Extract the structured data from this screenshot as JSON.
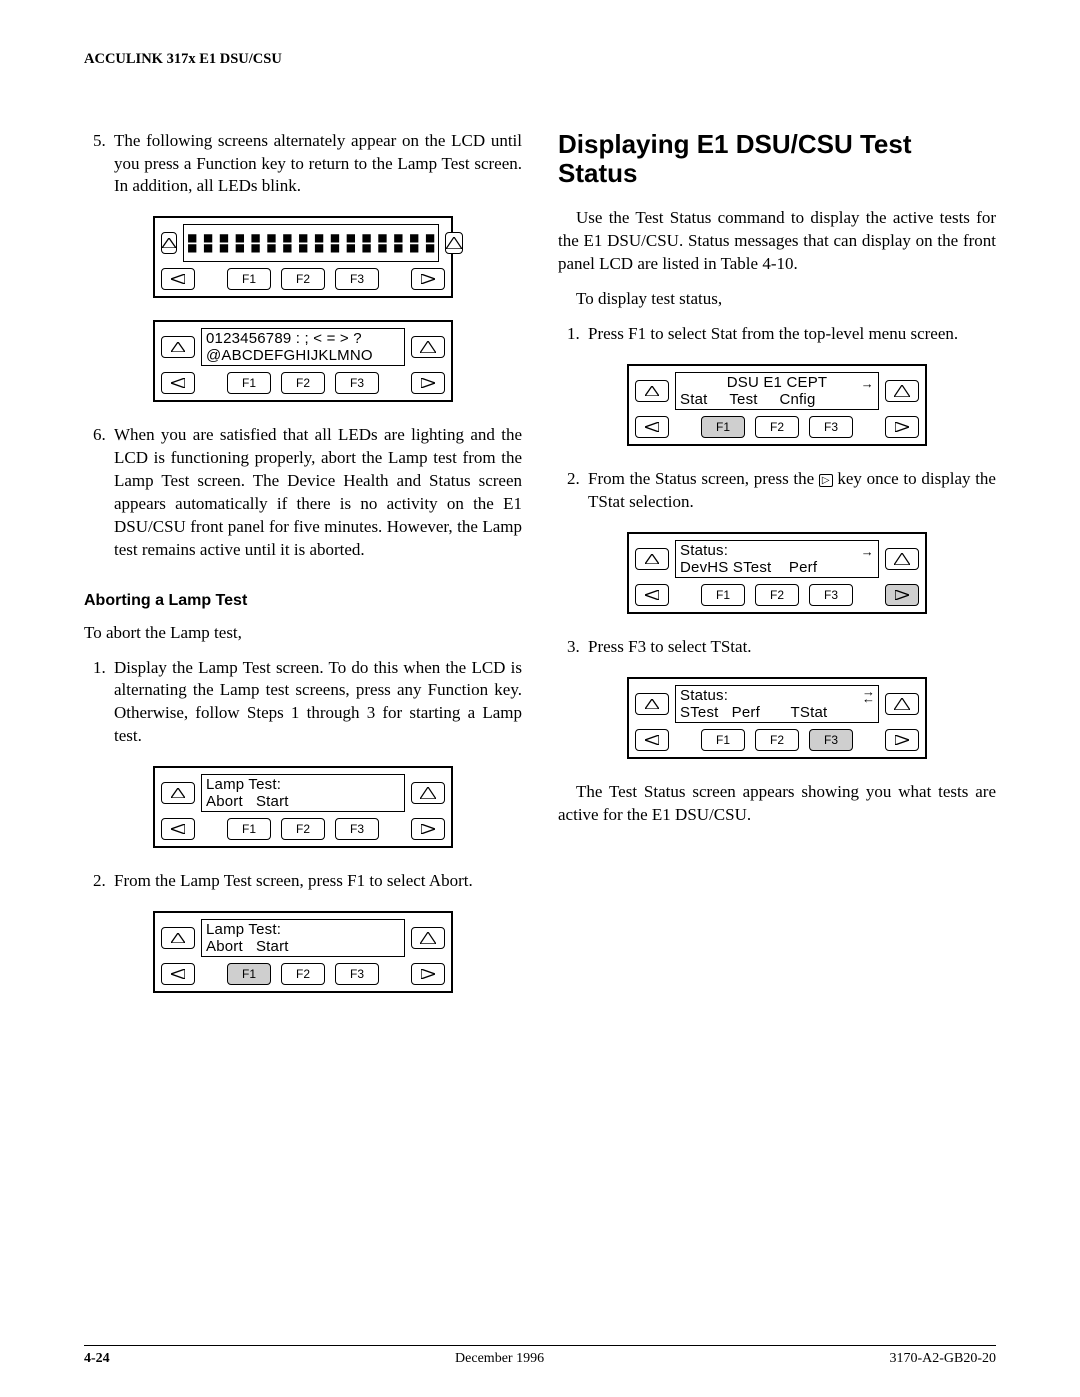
{
  "doc_header": "ACCULINK 317x E1 DSU/CSU",
  "footer": {
    "page": "4-24",
    "center": "December 1996",
    "right": "3170-A2-GB20-20"
  },
  "left": {
    "step5": "The following screens alternately appear on the LCD until you press a Function key to return to the Lamp Test screen. In addition, all LEDs blink.",
    "lcd2_line1": "0123456789 : ; < = > ?",
    "lcd2_line2": "@ABCDEFGHIJKLMNO",
    "step6": "When you are satisfied that all LEDs are lighting and the LCD is functioning properly, abort the Lamp test from the Lamp Test screen. The Device Health and Status screen appears automatically if there is no activity on the E1 DSU/CSU front panel for five minutes. However, the Lamp test remains active until it is aborted.",
    "abort_h": "Aborting a Lamp Test",
    "abort_intro": "To abort the Lamp test,",
    "abort_steps": {
      "s1": "Display the Lamp Test screen. To do this when the LCD is alternating the Lamp test screens, press any Function key. Otherwise, follow Steps 1 through 3 for starting a Lamp test.",
      "s2": "From the Lamp Test screen, press F1 to select Abort."
    },
    "lamp_line1": "Lamp Test:",
    "lamp_abort": "Abort",
    "lamp_start": "Start"
  },
  "right": {
    "h2": "Displaying E1 DSU/CSU Test Status",
    "intro": "Use the Test Status command to display the active tests for the E1 DSU/CSU. Status messages that can display on the front panel LCD are listed in Table 4-10.",
    "to_display": "To display test status,",
    "steps": {
      "s1": "Press F1 to select Stat from the top-level menu screen.",
      "s2_a": "From the Status screen, press the ",
      "s2_b": " key once to display the TStat selection.",
      "s3": "Press F3 to select TStat."
    },
    "menu1_line1": "DSU E1 CEPT",
    "menu1_stat": "Stat",
    "menu1_test": "Test",
    "menu1_cnfig": "Cnfig",
    "menu2_line1": "Status:",
    "menu2_a": "DevHS",
    "menu2_b": "STest",
    "menu2_c": "Perf",
    "menu3_line1": "Status:",
    "menu3_a": "STest",
    "menu3_b": "Perf",
    "menu3_c": "TStat",
    "closing": "The Test Status screen appears showing you what tests are active for the E1 DSU/CSU."
  },
  "keys": {
    "F1": "F1",
    "F2": "F2",
    "F3": "F3"
  }
}
